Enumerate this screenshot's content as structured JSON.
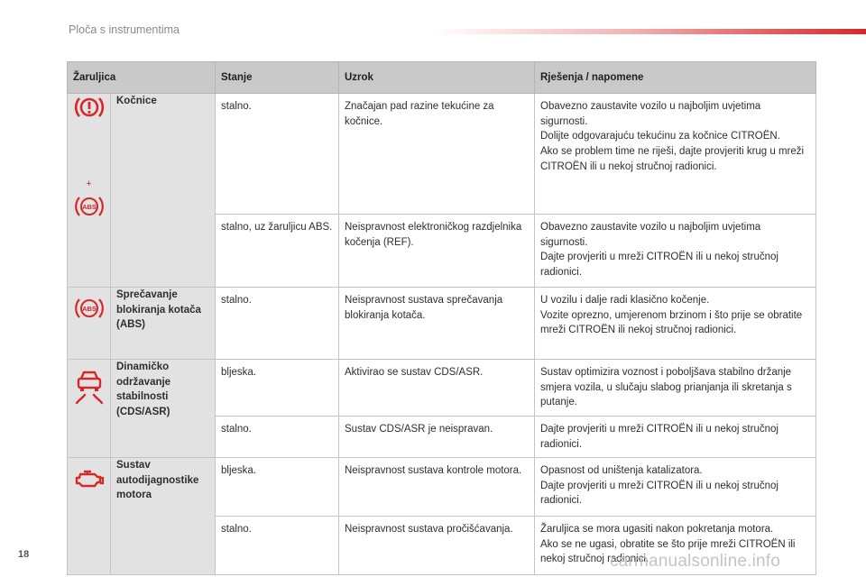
{
  "header": {
    "title": "Ploča s instrumentima"
  },
  "page_number": "18",
  "watermark": "carmanualsonline.info",
  "table": {
    "columns": [
      "Žaruljica",
      "Stanje",
      "Uzrok",
      "Rješenja / napomene"
    ],
    "groups": [
      {
        "name": "Kočnice",
        "icons": [
          "brake-warning-icon",
          "abs-icon"
        ],
        "plus": "+",
        "rows": [
          {
            "state": "stalno.",
            "cause": "Značajan pad razine tekućine za kočnice.",
            "solution": "Obavezno zaustavite vozilo u najboljim uvjetima sigurnosti.\nDolijte odgovarajuću tekućinu za kočnice CITROËN.\nAko se problem time ne riješi, dajte provjeriti krug u mreži CITROËN ili u nekoj stručnoj radionici."
          },
          {
            "state": "stalno, uz žaruljicu ABS.",
            "cause": "Neispravnost elektroničkog razdjelnika kočenja (REF).",
            "solution": "Obavezno zaustavite vozilo u najboljim uvjetima sigurnosti.\nDajte provjeriti u mreži CITROËN ili u nekoj stručnoj radionici."
          }
        ]
      },
      {
        "name": "Sprečavanje blokiranja kotača (ABS)",
        "icons": [
          "abs-icon"
        ],
        "rows": [
          {
            "state": "stalno.",
            "cause": "Neispravnost sustava sprečavanja blokiranja kotača.",
            "solution": "U vozilu i dalje radi klasično kočenje.\nVozite oprezno, umjerenom brzinom i što prije se obratite mreži CITROËN ili nekoj stručnoj radionici."
          }
        ]
      },
      {
        "name": "Dinamičko održavanje stabilnosti (CDS/ASR)",
        "icons": [
          "stability-control-icon"
        ],
        "rows": [
          {
            "state": "bljeska.",
            "cause": "Aktivirao se sustav CDS/ASR.",
            "solution": "Sustav optimizira voznost i poboljšava stabilno držanje smjera vozila, u slučaju slabog prianjanja ili skretanja s putanje."
          },
          {
            "state": "stalno.",
            "cause": "Sustav CDS/ASR je neispravan.",
            "solution": "Dajte provjeriti u mreži CITROËN ili u nekoj stručnoj radionici."
          }
        ]
      },
      {
        "name": "Sustav autodijagnostike motora",
        "icons": [
          "engine-diagnostic-icon"
        ],
        "rows": [
          {
            "state": "bljeska.",
            "cause": "Neispravnost sustava kontrole motora.",
            "solution": "Opasnost od uništenja katalizatora.\nDajte provjeriti u mreži CITROËN ili u nekoj stručnoj radionici."
          },
          {
            "state": "stalno.",
            "cause": "Neispravnost sustava pročišćavanja.",
            "solution": "Žaruljica se mora ugasiti nakon pokretanja motora.\nAko se ne ugasi, obratite se što prije mreži CITROËN ili nekoj stručnoj radionici."
          }
        ]
      }
    ]
  },
  "colors": {
    "accent": "#d62828",
    "header_bg": "#c9c9c9",
    "label_bg": "#e2e2e2",
    "border": "#c4c4c4"
  }
}
